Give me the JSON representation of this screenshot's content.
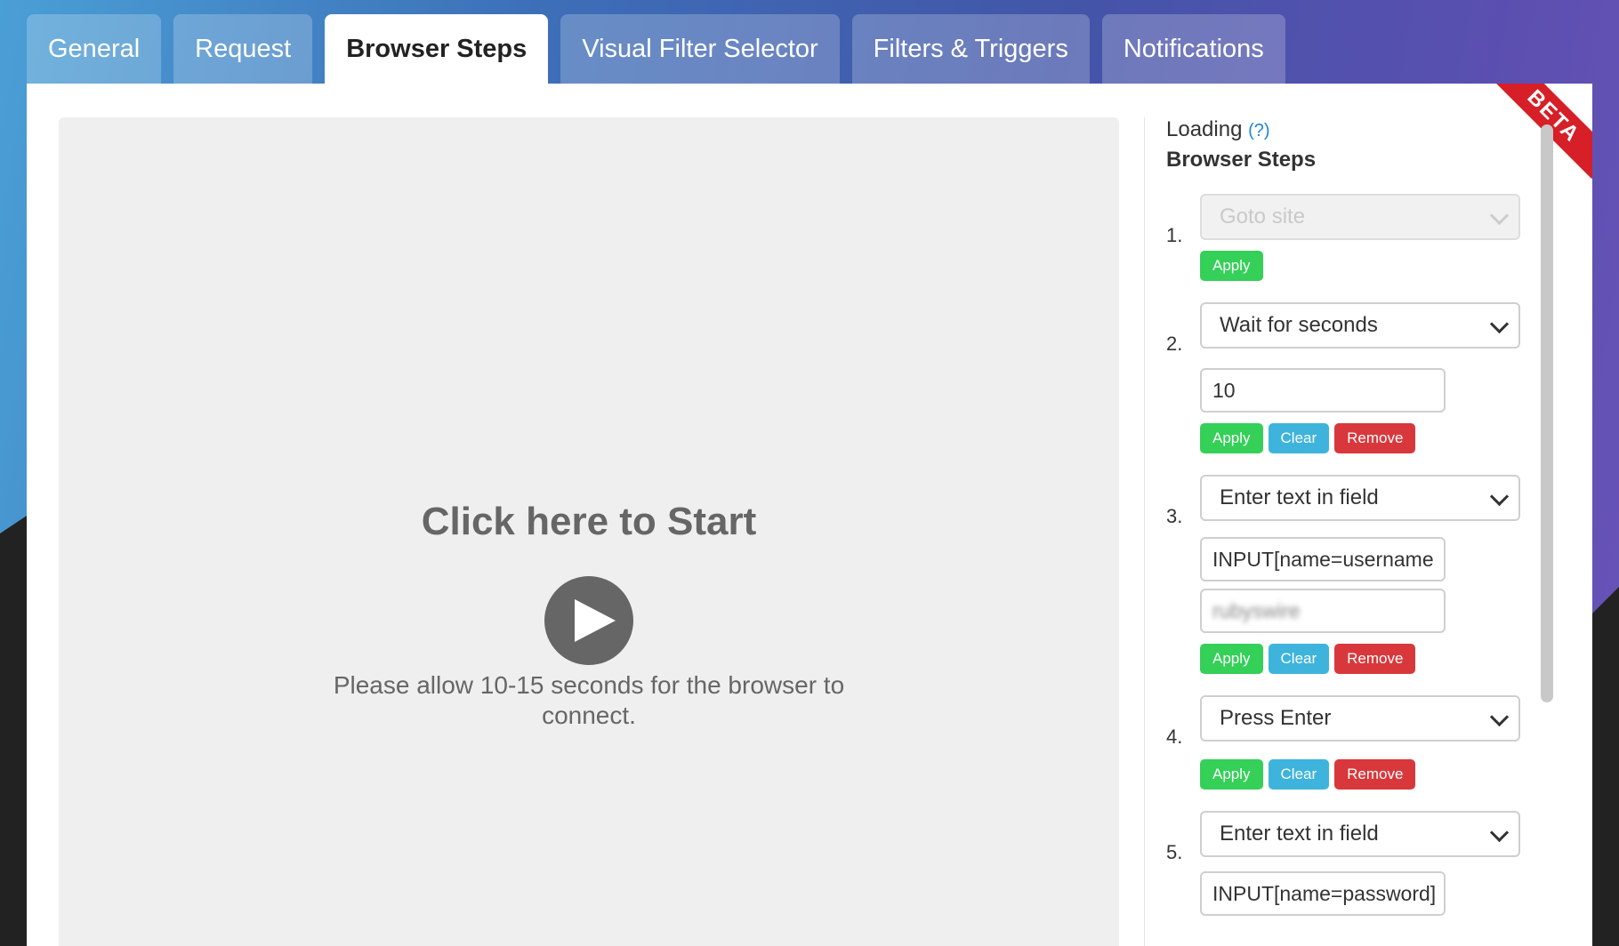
{
  "tabs": [
    {
      "label": "General"
    },
    {
      "label": "Request"
    },
    {
      "label": "Browser Steps"
    },
    {
      "label": "Visual Filter Selector"
    },
    {
      "label": "Filters & Triggers"
    },
    {
      "label": "Notifications"
    }
  ],
  "active_tab": "Browser Steps",
  "preview": {
    "title": "Click here to Start",
    "message": "Please allow 10-15 seconds for the browser to connect."
  },
  "badge": "BETA",
  "sidebar": {
    "loading": "Loading",
    "help": "?",
    "title": "Browser Steps",
    "steps": [
      {
        "num": "1.",
        "action": "Goto site",
        "apply": "Apply"
      },
      {
        "num": "2.",
        "action": "Wait for seconds",
        "value": "10",
        "apply": "Apply",
        "clear": "Clear",
        "remove": "Remove"
      },
      {
        "num": "3.",
        "action": "Enter text in field",
        "selector": "INPUT[name=username",
        "value": "rubyswire",
        "apply": "Apply",
        "clear": "Clear",
        "remove": "Remove"
      },
      {
        "num": "4.",
        "action": "Press Enter",
        "apply": "Apply",
        "clear": "Clear",
        "remove": "Remove"
      },
      {
        "num": "5.",
        "action": "Enter text in field",
        "selector": "INPUT[name=password]"
      }
    ]
  }
}
